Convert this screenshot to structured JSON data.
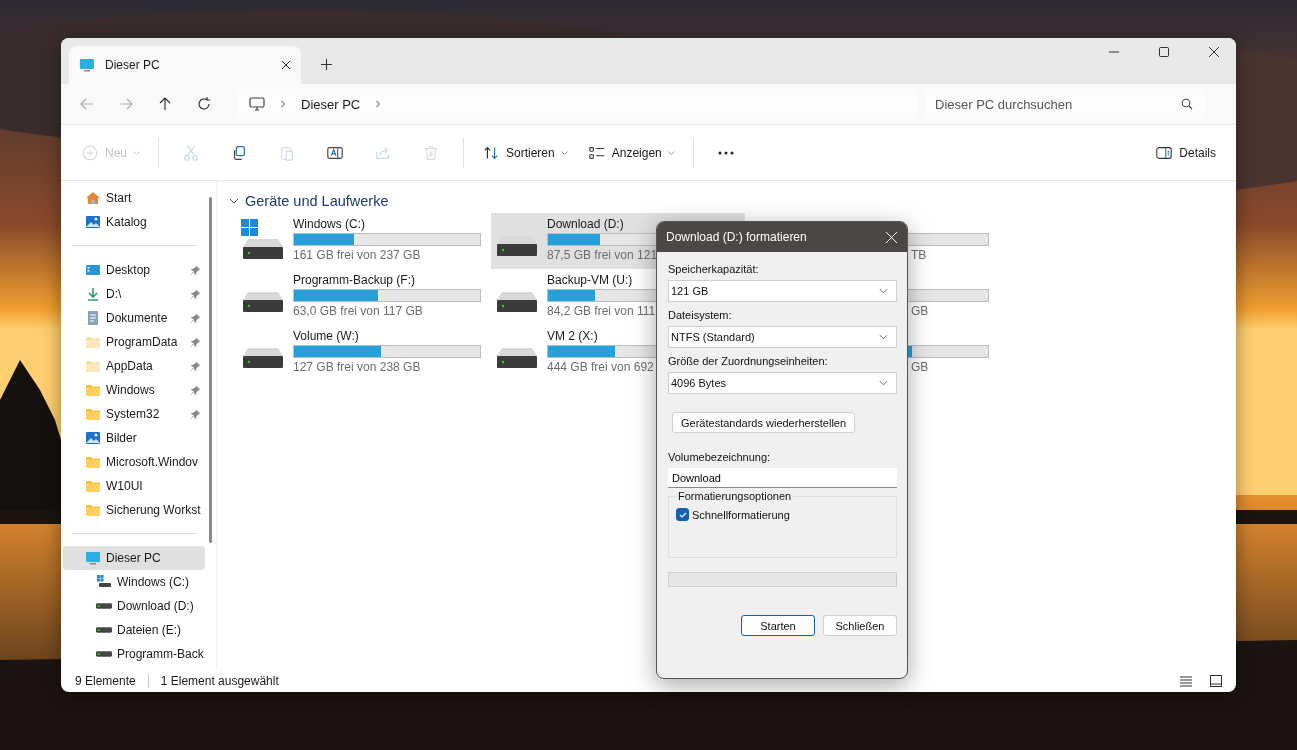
{
  "tabs": [
    {
      "label": "Dieser PC",
      "selected": true
    }
  ],
  "address": {
    "breadcrumb": [
      "Dieser PC"
    ]
  },
  "search": {
    "placeholder": "Dieser PC durchsuchen"
  },
  "toolbar": {
    "items": [
      {
        "kind": "new",
        "label": "Neu",
        "disabled": true
      },
      {
        "kind": "cut",
        "disabled": true
      },
      {
        "kind": "copy",
        "disabled": false
      },
      {
        "kind": "paste",
        "disabled": true
      },
      {
        "kind": "rename",
        "disabled": false
      },
      {
        "kind": "share",
        "disabled": true
      },
      {
        "kind": "delete",
        "disabled": true
      },
      {
        "kind": "sort",
        "label": "Sortieren",
        "disabled": false
      },
      {
        "kind": "view",
        "label": "Anzeigen",
        "disabled": false
      },
      {
        "kind": "more",
        "disabled": false
      }
    ],
    "details": "Details"
  },
  "sidebar": {
    "groups": [
      [
        {
          "kind": "home",
          "label": "Start",
          "pinned": false,
          "selected": false
        },
        {
          "kind": "gallery",
          "label": "Katalog",
          "pinned": false,
          "selected": false
        }
      ],
      [
        {
          "kind": "desktop",
          "label": "Desktop",
          "pinned": true,
          "selected": false
        },
        {
          "kind": "download",
          "label": "D:\\",
          "pinned": true,
          "selected": false
        },
        {
          "kind": "document",
          "label": "Dokumente",
          "pinned": true,
          "selected": false
        },
        {
          "kind": "folder-light",
          "label": "ProgramData",
          "pinned": true,
          "selected": false
        },
        {
          "kind": "folder-light",
          "label": "AppData",
          "pinned": true,
          "selected": false
        },
        {
          "kind": "folder",
          "label": "Windows",
          "pinned": true,
          "selected": false
        },
        {
          "kind": "folder",
          "label": "System32",
          "pinned": true,
          "selected": false
        },
        {
          "kind": "gallery",
          "label": "Bilder",
          "pinned": false,
          "selected": false
        },
        {
          "kind": "folder",
          "label": "Microsoft.Windov",
          "pinned": false,
          "selected": false
        },
        {
          "kind": "folder",
          "label": "W10UI",
          "pinned": false,
          "selected": false
        },
        {
          "kind": "folder",
          "label": "Sicherung Workst",
          "pinned": false,
          "selected": false
        }
      ],
      [
        {
          "kind": "pc",
          "label": "Dieser PC",
          "pinned": false,
          "selected": true,
          "children": [
            {
              "kind": "system-drive",
              "label": "Windows (C:)",
              "pinned": false,
              "selected": false
            },
            {
              "kind": "drive",
              "label": "Download (D:)",
              "pinned": false,
              "selected": false
            },
            {
              "kind": "drive",
              "label": "Dateien (E:)",
              "pinned": false,
              "selected": false
            },
            {
              "kind": "drive",
              "label": "Programm-Back",
              "pinned": false,
              "selected": false
            }
          ]
        }
      ]
    ]
  },
  "section": {
    "title": "Geräte und Laufwerke",
    "expanded": true
  },
  "drives": [
    {
      "kind": "system",
      "name": "Windows (C:)",
      "free": "161 GB frei von 237 GB",
      "level": 0.32,
      "selected": false
    },
    {
      "kind": "drive",
      "name": "Download (D:)",
      "free": "87,5 GB frei von 121",
      "level": 0.28,
      "selected": true
    },
    {
      "kind": "partial",
      "free": "TB"
    },
    {
      "kind": "drive",
      "name": "Programm-Backup (F:)",
      "free": "63,0 GB frei von 117 GB",
      "level": 0.45,
      "selected": false
    },
    {
      "kind": "drive",
      "name": "Backup-VM (U:)",
      "free": "84,2 GB frei von 111",
      "level": 0.25,
      "selected": false
    },
    {
      "kind": "partial",
      "free": "GB"
    },
    {
      "kind": "drive",
      "name": "Volume (W:)",
      "free": "127 GB frei von 238 GB",
      "level": 0.47,
      "selected": false
    },
    {
      "kind": "drive",
      "name": "VM 2 (X:)",
      "free": "444 GB frei von 692",
      "level": 0.36,
      "selected": false
    },
    {
      "kind": "partial",
      "free": "GB",
      "level": 0.59
    }
  ],
  "status_bar": {
    "count": "9 Elemente",
    "selection": "1 Element ausgewählt"
  },
  "dialog": {
    "title": "Download (D:) formatieren",
    "fields": [
      {
        "label": "Speicherkapazität:",
        "value": "121 GB"
      },
      {
        "label": "Dateisystem:",
        "value": "NTFS (Standard)"
      },
      {
        "label": "Größe der Zuordnungseinheiten:",
        "value": "4096 Bytes"
      }
    ],
    "restore_button": "Gerätestandards wiederherstellen",
    "volume": {
      "label": "Volumebezeichnung:",
      "value": "Download"
    },
    "options": {
      "title": "Formatierungsoptionen",
      "quick_format": {
        "label": "Schnellformatierung",
        "checked": true
      }
    },
    "progress": {
      "level": 0
    },
    "buttons": [
      {
        "label": "Starten",
        "default": true
      },
      {
        "label": "Schließen",
        "default": false
      }
    ]
  }
}
